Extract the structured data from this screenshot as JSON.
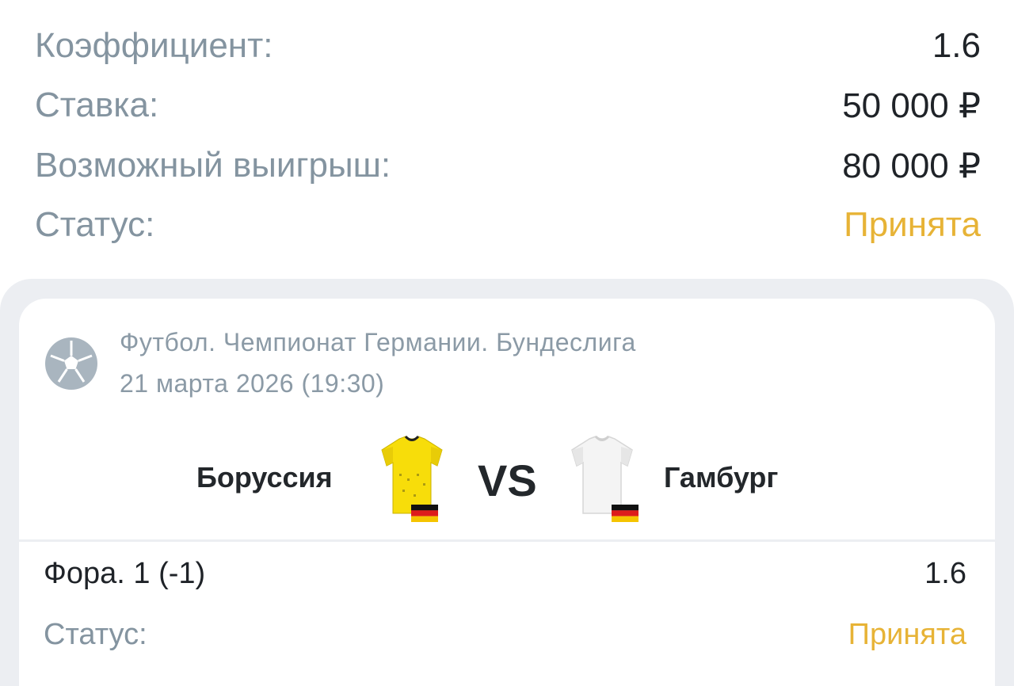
{
  "summary": {
    "rows": [
      {
        "label": "Коэффициент:",
        "value": "1.6"
      },
      {
        "label": "Ставка:",
        "value": "50 000 ₽"
      },
      {
        "label": "Возможный выигрыш:",
        "value": "80 000 ₽"
      },
      {
        "label": "Статус:",
        "value": "Принята"
      }
    ]
  },
  "event": {
    "sport_icon": "soccer-ball-icon",
    "league": "Футбол. Чемпионат Германии. Бундеслига",
    "datetime": "21 марта 2026 (19:30)",
    "home_team": {
      "name": "Боруссия",
      "kit_color": "#f7dd0a",
      "flag": "germany-flag-icon"
    },
    "vs": "VS",
    "away_team": {
      "name": "Гамбург",
      "kit_color": "#f4f4f4",
      "flag": "germany-flag-icon"
    }
  },
  "bet": {
    "market": "Фора. 1 (-1)",
    "odds": "1.6",
    "status_label": "Статус:",
    "status_value": "Принята"
  },
  "colors": {
    "accent": "#e7b336",
    "muted_text": "#8494a0",
    "primary_text": "#1f2328",
    "panel_bg": "#eceef2"
  }
}
